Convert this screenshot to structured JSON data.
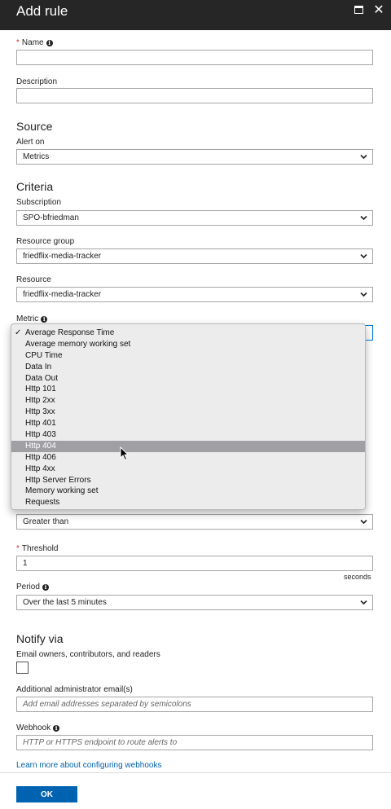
{
  "window": {
    "title": "Add rule"
  },
  "name": {
    "label": "Name",
    "value": ""
  },
  "description": {
    "label": "Description",
    "value": ""
  },
  "source": {
    "heading": "Source",
    "alert_on_label": "Alert on",
    "alert_on_value": "Metrics"
  },
  "criteria": {
    "heading": "Criteria",
    "subscription_label": "Subscription",
    "subscription_value": "SPO-bfriedman",
    "resource_group_label": "Resource group",
    "resource_group_value": "friedflix-media-tracker",
    "resource_label": "Resource",
    "resource_value": "friedflix-media-tracker",
    "metric_label": "Metric",
    "metric_options": [
      "Average Response Time",
      "Average memory working set",
      "CPU Time",
      "Data In",
      "Data Out",
      "Http 101",
      "Http 2xx",
      "Http 3xx",
      "Http 401",
      "Http 403",
      "Http 404",
      "Http 406",
      "Http 4xx",
      "Http Server Errors",
      "Memory working set",
      "Requests"
    ],
    "metric_checked": "Average Response Time",
    "metric_highlighted": "Http 404",
    "condition_value": "Greater than",
    "threshold_label": "Threshold",
    "threshold_value": "1",
    "threshold_unit": "seconds",
    "period_label": "Period",
    "period_value": "Over the last 5 minutes"
  },
  "notify": {
    "heading": "Notify via",
    "email_owners_label": "Email owners, contributors, and readers",
    "email_owners_checked": false,
    "admin_email_label": "Additional administrator email(s)",
    "admin_email_placeholder": "Add email addresses separated by semicolons",
    "webhook_label": "Webhook",
    "webhook_placeholder": "HTTP or HTTPS endpoint to route alerts to",
    "learn_more_link": "Learn more about configuring webhooks"
  },
  "footer": {
    "ok_label": "OK"
  },
  "colors": {
    "accent": "#0063b1",
    "link": "#0062ad",
    "required": "#d13438",
    "titlebar": "#262626"
  }
}
